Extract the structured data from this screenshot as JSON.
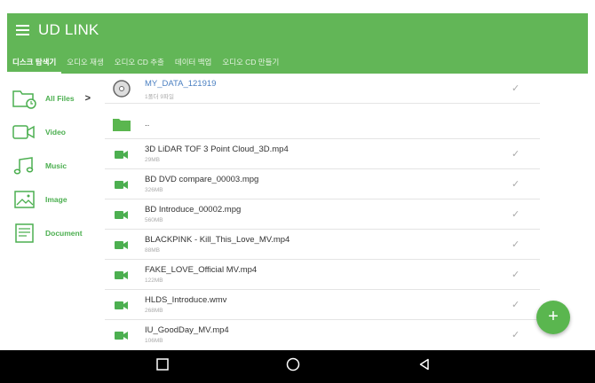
{
  "app": {
    "title": "UD LINK"
  },
  "tabs": [
    {
      "label": "디스크 탐색기",
      "active": true
    },
    {
      "label": "오디오 재생"
    },
    {
      "label": "오디오 CD 추출"
    },
    {
      "label": "데이터 백업"
    },
    {
      "label": "오디오 CD 만들기"
    }
  ],
  "sidebar": {
    "items": [
      {
        "label": "All Files",
        "arrow": ">"
      },
      {
        "label": "Video"
      },
      {
        "label": "Music"
      },
      {
        "label": "Image"
      },
      {
        "label": "Document"
      }
    ]
  },
  "disc": {
    "name": "MY_DATA_121919",
    "info": "1폴더 9파일"
  },
  "parent": {
    "name": ".."
  },
  "files": [
    {
      "name": "3D LiDAR TOF 3 Point Cloud_3D.mp4",
      "size": "29MB"
    },
    {
      "name": "BD DVD compare_00003.mpg",
      "size": "326MB"
    },
    {
      "name": "BD Introduce_00002.mpg",
      "size": "560MB"
    },
    {
      "name": "BLACKPINK - Kill_This_Love_MV.mp4",
      "size": "88MB"
    },
    {
      "name": "FAKE_LOVE_Official MV.mp4",
      "size": "122MB"
    },
    {
      "name": "HLDS_Introduce.wmv",
      "size": "268MB"
    },
    {
      "name": "IU_GoodDay_MV.mp4",
      "size": "106MB"
    }
  ],
  "fab": {
    "label": "+"
  },
  "colors": {
    "primary": "#62b657",
    "accent": "#4caf50",
    "link": "#4a7fc1",
    "navbar": "#000000"
  },
  "icons": {
    "menu": "hamburger-icon",
    "disc": "disc-icon",
    "folder": "folder-icon",
    "video": "video-camera-icon",
    "check": "checkmark-icon"
  }
}
